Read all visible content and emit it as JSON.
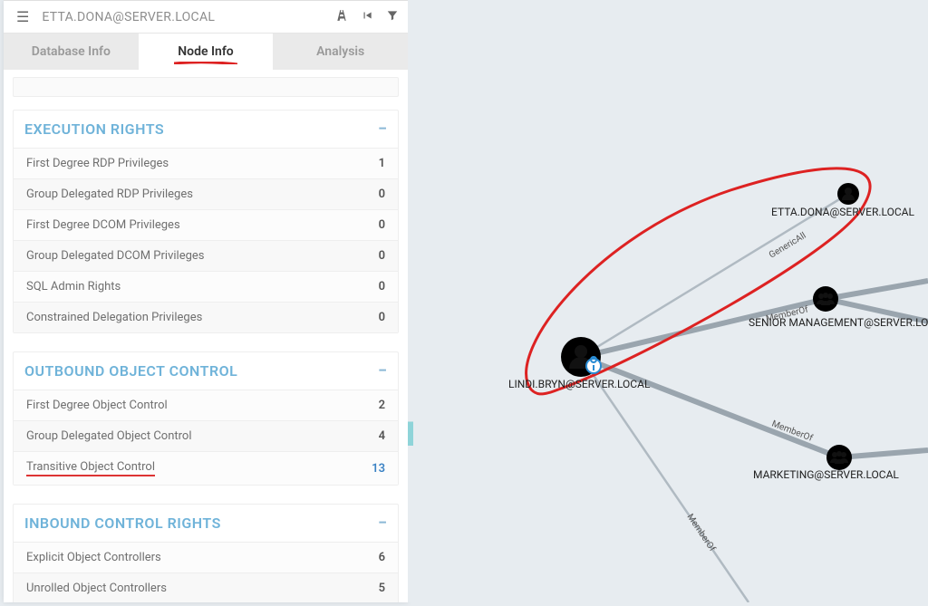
{
  "header": {
    "node_title": "ETTA.DONA@SERVER.LOCAL"
  },
  "tabs": {
    "database": "Database Info",
    "node": "Node Info",
    "analysis": "Analysis"
  },
  "sections": {
    "exec": {
      "title": "EXECUTION RIGHTS",
      "rows": [
        {
          "label": "First Degree RDP Privileges",
          "value": "1"
        },
        {
          "label": "Group Delegated RDP Privileges",
          "value": "0"
        },
        {
          "label": "First Degree DCOM Privileges",
          "value": "0"
        },
        {
          "label": "Group Delegated DCOM Privileges",
          "value": "0"
        },
        {
          "label": "SQL Admin Rights",
          "value": "0"
        },
        {
          "label": "Constrained Delegation Privileges",
          "value": "0"
        }
      ]
    },
    "outbound": {
      "title": "OUTBOUND OBJECT CONTROL",
      "rows": [
        {
          "label": "First Degree Object Control",
          "value": "2"
        },
        {
          "label": "Group Delegated Object Control",
          "value": "4"
        },
        {
          "label": "Transitive Object Control",
          "value": "13",
          "highlight": true,
          "underline": true
        }
      ]
    },
    "inbound": {
      "title": "INBOUND CONTROL RIGHTS",
      "rows": [
        {
          "label": "Explicit Object Controllers",
          "value": "6"
        },
        {
          "label": "Unrolled Object Controllers",
          "value": "5"
        }
      ]
    }
  },
  "graph": {
    "nodes": {
      "etta": {
        "label": "ETTA.DONA@SERVER.LOCAL",
        "type": "user",
        "color": "green"
      },
      "lindi": {
        "label": "LINDI.BRYN@SERVER.LOCAL",
        "type": "user",
        "color": "green",
        "pinned": true
      },
      "senior": {
        "label": "SENIOR MANAGEMENT@SERVER.LOCAL",
        "type": "group"
      },
      "marketing": {
        "label": "MARKETING@SERVER.LOCAL",
        "type": "group"
      }
    },
    "edges": {
      "e1": "GenericAll",
      "e2": "MemberOf",
      "e3": "MemberOf",
      "e4": "MemberOf"
    }
  }
}
